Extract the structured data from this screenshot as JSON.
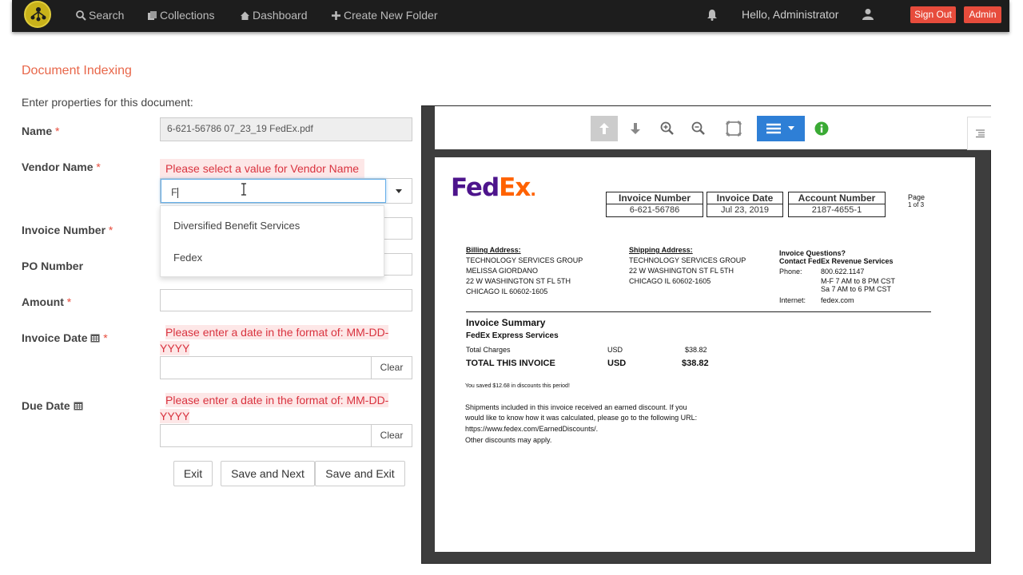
{
  "nav": {
    "search": "Search",
    "collections": "Collections",
    "dashboard": "Dashboard",
    "create_folder": "Create New Folder",
    "greeting": "Hello, Administrator",
    "sign_out": "Sign Out",
    "admin": "Admin"
  },
  "form": {
    "title": "Document Indexing",
    "subtitle": "Enter properties for this document:",
    "name_label": "Name",
    "name_value": "6-621-56786 07_23_19 FedEx.pdf",
    "vendor_label": "Vendor Name",
    "vendor_error": "Please select a value for Vendor Name",
    "vendor_value": "F",
    "vendor_options": [
      "Diversified Benefit Services",
      "Fedex"
    ],
    "invoice_number_label": "Invoice Number",
    "po_number_label": "PO Number",
    "amount_label": "Amount",
    "invoice_date_label": "Invoice Date",
    "invoice_date_error": "Please enter a date in the format of: MM-DD-YYYY",
    "due_date_label": "Due Date",
    "due_date_error": "Please enter a date in the format of: MM-DD-YYYY",
    "required_mark": "*",
    "clear": "Clear",
    "exit": "Exit",
    "save_next": "Save and Next",
    "save_exit": "Save and Exit"
  },
  "document": {
    "logo_fed": "Fed",
    "logo_ex": "Ex",
    "logo_dot": ".",
    "invoice_number_hdr": "Invoice Number",
    "invoice_number": "6-621-56786",
    "invoice_date_hdr": "Invoice Date",
    "invoice_date": "Jul 23, 2019",
    "account_number_hdr": "Account Number",
    "account_number": "2187-4655-1",
    "page_label": "Page",
    "page_of": "1 of 3",
    "billing_hdr": "Billing Address:",
    "billing_lines": [
      "TECHNOLOGY SERVICES GROUP",
      "MELISSA GIORDANO",
      "22 W WASHINGTON ST FL 5TH",
      "CHICAGO IL  60602-1605"
    ],
    "shipping_hdr": "Shipping Address:",
    "shipping_lines": [
      "TECHNOLOGY SERVICES GROUP",
      "22 W WASHINGTON ST FL 5TH",
      "CHICAGO IL  60602-1605"
    ],
    "questions_hdr": "Invoice Questions?",
    "contact_hdr": "Contact FedEx Revenue Services",
    "phone_label": "Phone:",
    "phone": "800.622.1147",
    "hours1": "M-F 7 AM to 8 PM CST",
    "hours2": "Sa  7 AM to 6 PM CST",
    "internet_label": "Internet:",
    "internet": "fedex.com",
    "summary_hdr": "Invoice Summary",
    "express": "FedEx Express Services",
    "total_charges": "Total Charges",
    "usd": "USD",
    "total_charges_amt": "$38.82",
    "total_invoice": "TOTAL THIS INVOICE",
    "total_invoice_amt": "$38.82",
    "saved": "You saved $12.68 in discounts this period!",
    "ship_note1": "Shipments included in this invoice received an earned discount. If you",
    "ship_note2": "would like to know how it was calculated, please go to the following URL:",
    "ship_note3": "https://www.fedex.com/EarnedDiscounts/.",
    "ship_note4": "Other discounts may apply."
  },
  "colors": {
    "accent": "#e8674a",
    "error": "#d9333f",
    "primary": "#2e7fd6",
    "fedex_purple": "#4d148c",
    "fedex_orange": "#ff6200"
  }
}
